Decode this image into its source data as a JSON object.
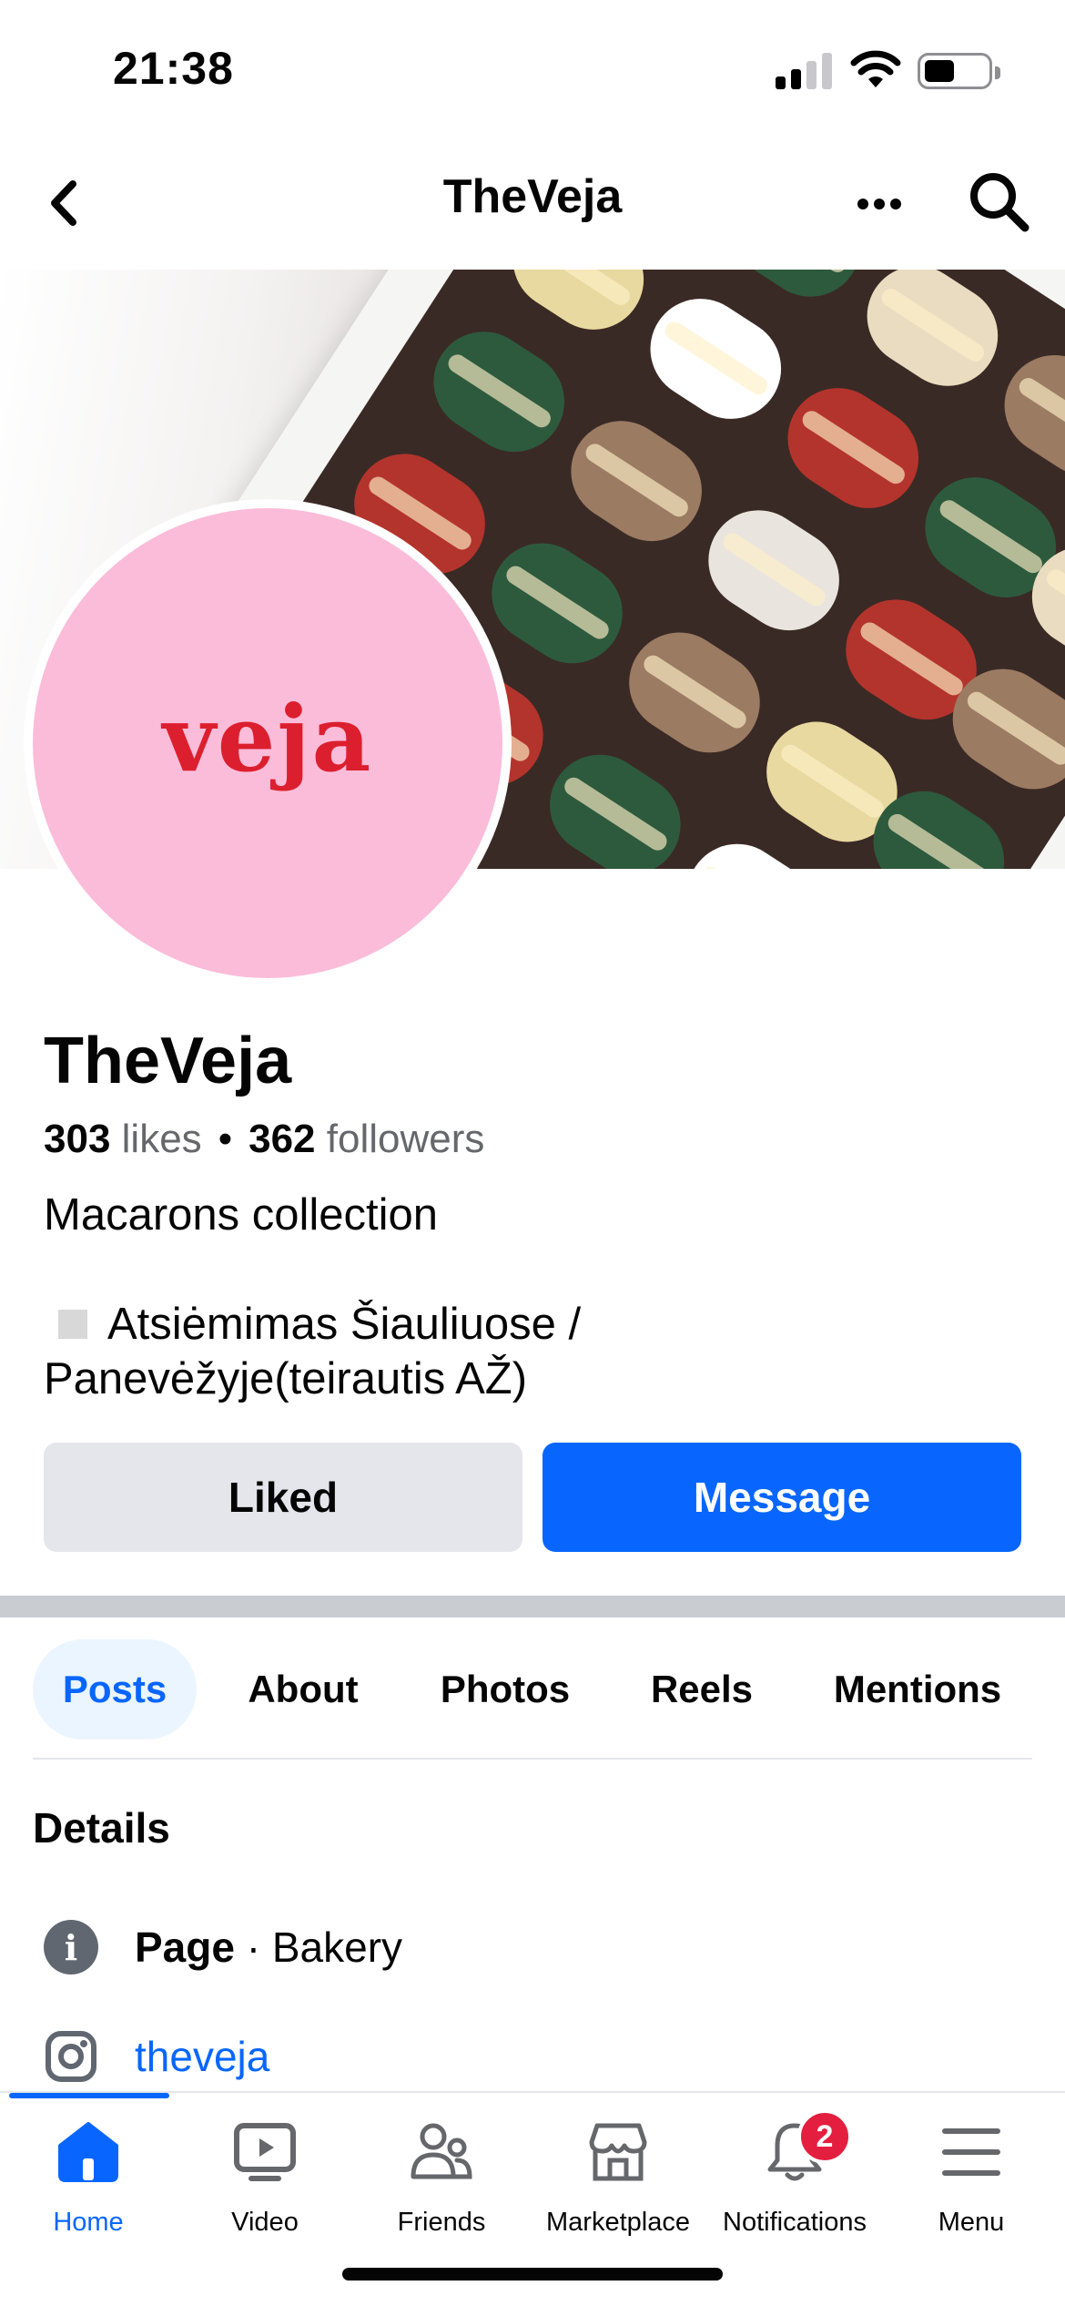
{
  "status_bar": {
    "time": "21:38"
  },
  "header": {
    "title": "TheVeja"
  },
  "avatar": {
    "logo_text": "veja"
  },
  "profile": {
    "name": "TheVeja",
    "likes_count": "303",
    "likes_label": "likes",
    "followers_count": "362",
    "followers_label": "followers",
    "bio": "Macarons collection",
    "location_line1": "Atsiėmimas Šiauliuose /",
    "location_line2": "Panevėžyje(teirautis AŽ)"
  },
  "actions": {
    "liked_label": "Liked",
    "message_label": "Message"
  },
  "tabs": [
    {
      "label": "Posts",
      "active": true
    },
    {
      "label": "About",
      "active": false
    },
    {
      "label": "Photos",
      "active": false
    },
    {
      "label": "Reels",
      "active": false
    },
    {
      "label": "Mentions",
      "active": false
    }
  ],
  "details": {
    "title": "Details",
    "category_label": "Page",
    "category_separator": "·",
    "category_value": "Bakery",
    "instagram_handle": "theveja"
  },
  "bottom_nav": [
    {
      "label": "Home",
      "icon": "home-icon",
      "active": true
    },
    {
      "label": "Video",
      "icon": "video-icon",
      "active": false
    },
    {
      "label": "Friends",
      "icon": "friends-icon",
      "active": false
    },
    {
      "label": "Marketplace",
      "icon": "marketplace-icon",
      "active": false
    },
    {
      "label": "Notifications",
      "icon": "bell-icon",
      "active": false,
      "badge": "2"
    },
    {
      "label": "Menu",
      "icon": "menu-icon",
      "active": false
    }
  ],
  "colors": {
    "accent": "#0866ff",
    "avatar_background": "#fbbcd9",
    "logo_red": "#dc1f2e",
    "badge_red": "#e41e3f",
    "secondary_button": "#e4e6eb"
  }
}
